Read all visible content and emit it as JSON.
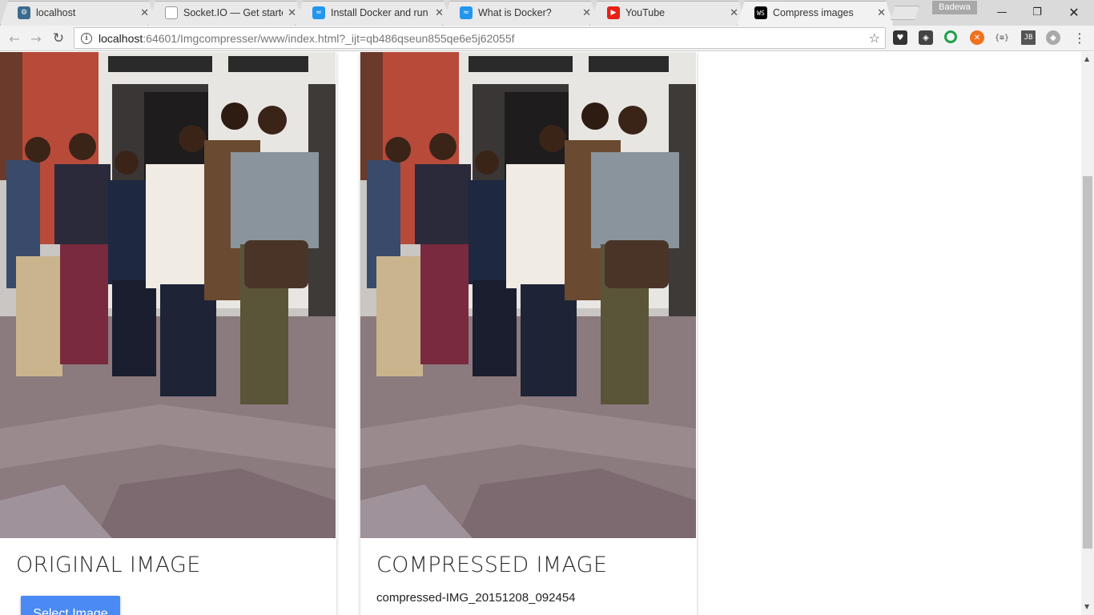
{
  "browser": {
    "tabs": [
      {
        "title": "localhost",
        "favicon": "cog-icon",
        "color": "#3d6b8f",
        "active": false
      },
      {
        "title": "Socket.IO — Get started",
        "favicon": "document-icon",
        "color": "#9e9e9e",
        "active": false
      },
      {
        "title": "Install Docker and run",
        "favicon": "docker-icon",
        "color": "#2496ed",
        "active": false
      },
      {
        "title": "What is Docker?",
        "favicon": "docker-icon",
        "color": "#2496ed",
        "active": false
      },
      {
        "title": "YouTube",
        "favicon": "youtube-icon",
        "color": "#e62117",
        "active": false
      },
      {
        "title": "Compress images",
        "favicon": "webstorm-icon",
        "color": "#000000",
        "active": true
      }
    ],
    "profile_name": "Badewa",
    "address": {
      "host": "localhost",
      "path": ":64601/Imgcompresser/www/index.html?_ijt=qb486qseun855qe6e5j62055f"
    }
  },
  "page": {
    "original": {
      "heading": "ORIGINAL IMAGE",
      "button_label": "Select Image"
    },
    "compressed": {
      "heading": "COMPRESSED IMAGE",
      "filename": "compressed-IMG_20151208_092454"
    }
  },
  "colors": {
    "accent": "#4a8af4",
    "tab_bar": "#dadada"
  }
}
